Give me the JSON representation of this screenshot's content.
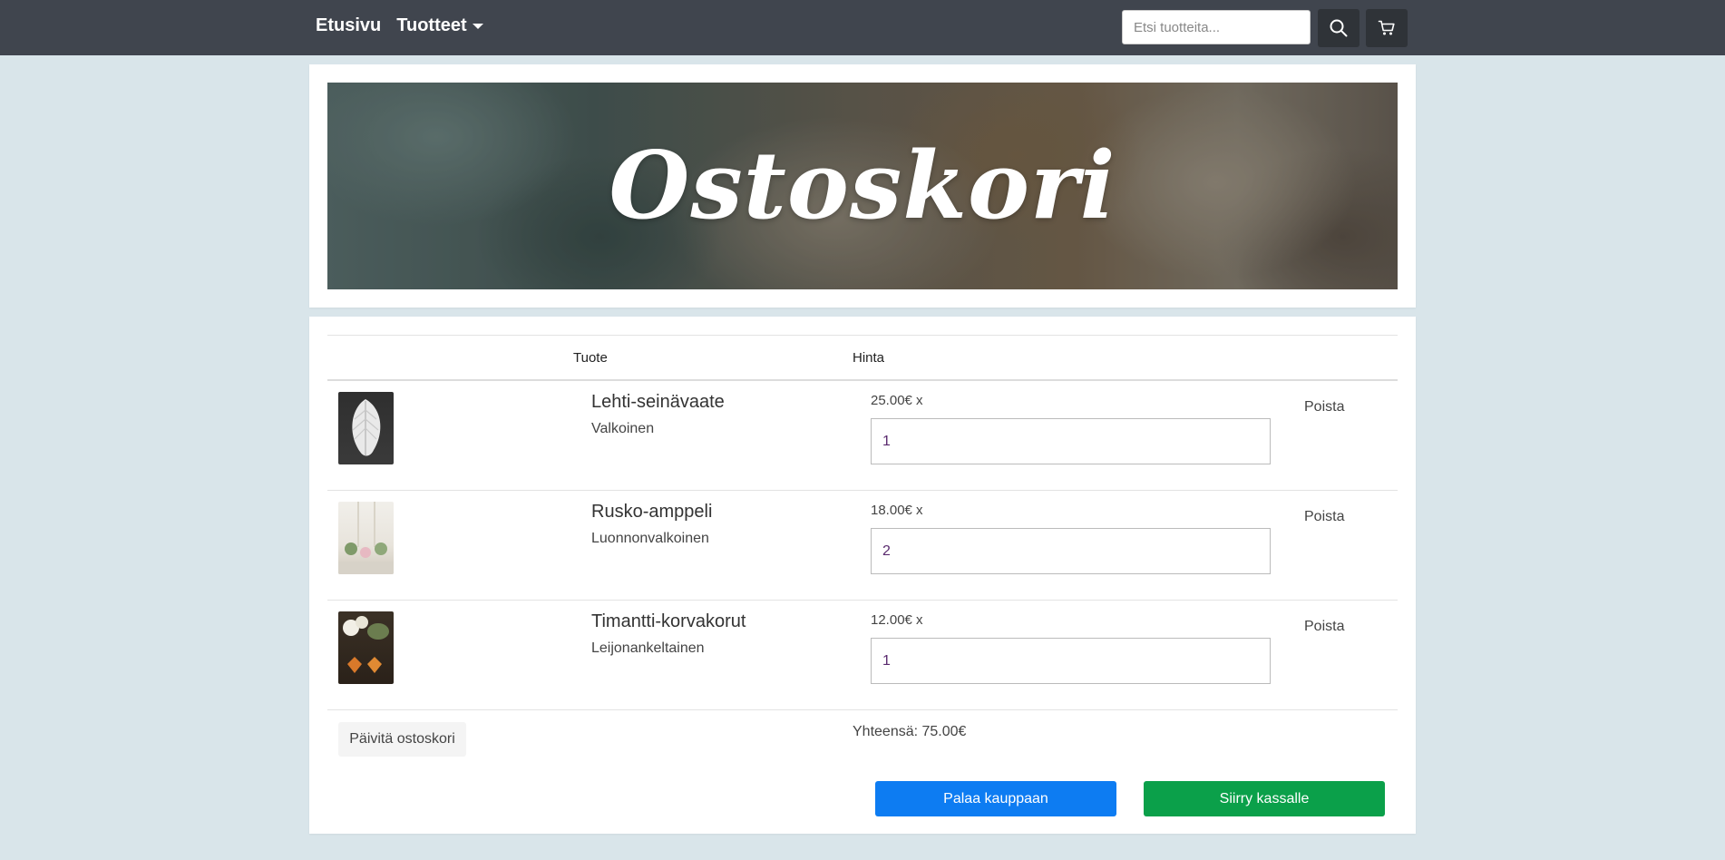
{
  "nav": {
    "home": "Etusivu",
    "products": "Tuotteet",
    "search_placeholder": "Etsi tuotteita..."
  },
  "hero": {
    "title": "Ostoskori"
  },
  "table": {
    "headers": {
      "product": "Tuote",
      "price": "Hinta"
    },
    "items": [
      {
        "name": "Lehti-seinävaate",
        "variant": "Valkoinen",
        "price": "25.00€ x",
        "qty": "1",
        "remove": "Poista"
      },
      {
        "name": "Rusko-amppeli",
        "variant": "Luonnonvalkoinen",
        "price": "18.00€ x",
        "qty": "2",
        "remove": "Poista"
      },
      {
        "name": "Timantti-korvakorut",
        "variant": "Leijonankeltainen",
        "price": "12.00€ x",
        "qty": "1",
        "remove": "Poista"
      }
    ]
  },
  "footer": {
    "update": "Päivitä ostoskori",
    "total": "Yhteensä: 75.00€",
    "back": "Palaa kauppaan",
    "checkout": "Siirry kassalle"
  },
  "colors": {
    "navbar": "#40454e",
    "background": "#d9e5ea",
    "primary": "#0d7cf2",
    "success": "#0ba04a"
  },
  "icons": [
    "search-icon",
    "cart-icon",
    "caret-down-icon"
  ]
}
